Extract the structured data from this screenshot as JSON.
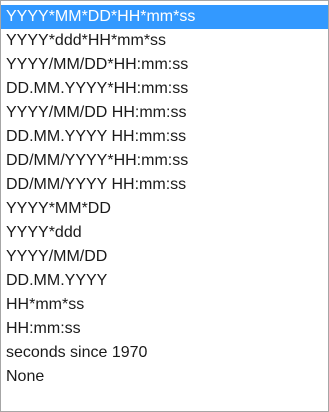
{
  "dropdown": {
    "selected_index": 0,
    "options": [
      "YYYY*MM*DD*HH*mm*ss",
      "YYYY*ddd*HH*mm*ss",
      "YYYY/MM/DD*HH:mm:ss",
      "DD.MM.YYYY*HH:mm:ss",
      "YYYY/MM/DD HH:mm:ss",
      "DD.MM.YYYY HH:mm:ss",
      "DD/MM/YYYY*HH:mm:ss",
      "DD/MM/YYYY HH:mm:ss",
      "YYYY*MM*DD",
      "YYYY*ddd",
      "YYYY/MM/DD",
      "DD.MM.YYYY",
      "HH*mm*ss",
      "HH:mm:ss",
      "seconds since 1970",
      "None"
    ]
  },
  "colors": {
    "highlight_background": "#3399ff",
    "highlight_text": "#ffffff",
    "text": "#1a1a1a",
    "border": "#a6a6a6"
  }
}
